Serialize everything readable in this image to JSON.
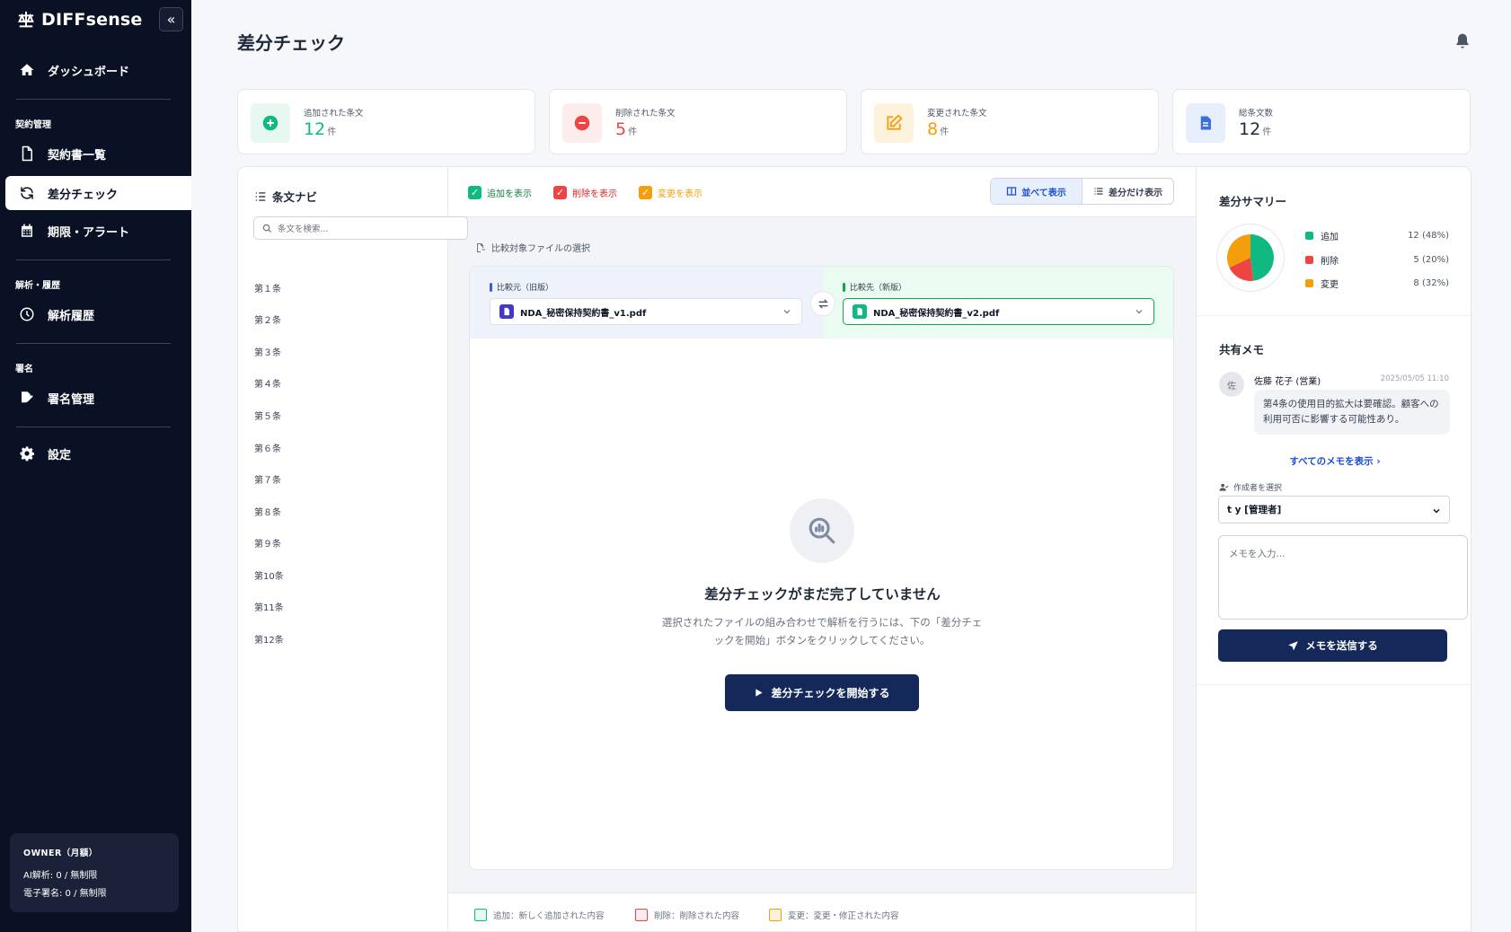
{
  "app": {
    "brand": "DIFFsense"
  },
  "sidebar": {
    "collapse_icon": "chevrons-left-icon",
    "items": [
      {
        "label": "ダッシュボード",
        "icon": "home-icon"
      },
      {
        "label": "契約書一覧",
        "icon": "file-icon"
      },
      {
        "label": "差分チェック",
        "icon": "refresh-icon",
        "active": true
      },
      {
        "label": "期限・アラート",
        "icon": "calendar-icon"
      },
      {
        "label": "解析履歴",
        "icon": "clock-icon"
      },
      {
        "label": "署名管理",
        "icon": "signature-icon"
      },
      {
        "label": "設定",
        "icon": "gear-icon"
      }
    ],
    "sections": [
      "契約管理",
      "解析・履歴",
      "署名"
    ],
    "plan": {
      "title": "OWNER（月額）",
      "ai_usage": "AI解析: 0 / 無制限",
      "esign_usage": "電子署名: 0 / 無制限"
    }
  },
  "header": {
    "title": "差分チェック"
  },
  "stats": [
    {
      "label": "追加された条文",
      "value": "12",
      "unit": "件",
      "color": "#10b981",
      "bg": "#e7f8f0",
      "icon": "plus-circle-icon"
    },
    {
      "label": "削除された条文",
      "value": "5",
      "unit": "件",
      "color": "#ef4444",
      "bg": "#fdecec",
      "icon": "minus-circle-icon"
    },
    {
      "label": "変更された条文",
      "value": "8",
      "unit": "件",
      "color": "#f59e0b",
      "bg": "#fdf3dc",
      "icon": "edit-icon"
    },
    {
      "label": "総条文数",
      "value": "12",
      "unit": "件",
      "color": "#1f2937",
      "bg": "#e8effc",
      "icon": "document-icon"
    }
  ],
  "clause_nav": {
    "title": "条文ナビ",
    "search_placeholder": "条文を検索...",
    "items": [
      "第１条",
      "第２条",
      "第３条",
      "第４条",
      "第５条",
      "第６条",
      "第７条",
      "第８条",
      "第９条",
      "第10条",
      "第11条",
      "第12条"
    ]
  },
  "toolbar": {
    "show_added": "追加を表示",
    "show_deleted": "削除を表示",
    "show_changed": "変更を表示",
    "side_by_side": "並べて表示",
    "diff_only": "差分だけ表示"
  },
  "file_selection": {
    "label": "比較対象ファイルの選択",
    "old_label": "比較元（旧版）",
    "new_label": "比較先（新版）",
    "old_file": "NDA_秘密保持契約書_v1.pdf",
    "new_file": "NDA_秘密保持契約書_v2.pdf"
  },
  "empty_state": {
    "title": "差分チェックがまだ完了していません",
    "description": "選択されたファイルの組み合わせで解析を行うには、下の「差分チェックを開始」ボタンをクリックしてください。",
    "button": "差分チェックを開始する"
  },
  "legend": {
    "added": "追加：新しく追加された内容",
    "deleted": "削除：削除された内容",
    "changed": "変更：変更・修正された内容"
  },
  "summary": {
    "title": "差分サマリー",
    "chart_data": {
      "type": "pie",
      "labels": [
        "追加",
        "削除",
        "変更"
      ],
      "values": [
        12,
        5,
        8
      ],
      "colors": [
        "#10b981",
        "#ef4444",
        "#f59e0b"
      ],
      "display": [
        "12 (48%)",
        "5 (20%)",
        "8 (32%)"
      ]
    }
  },
  "memo": {
    "title": "共有メモ",
    "avatar": "佐",
    "author": "佐藤 花子 (営業)",
    "time": "2025/05/05 11:10",
    "text": "第4条の使用目的拡大は要確認。顧客への利用可否に影響する可能性あり。",
    "view_all": "すべてのメモを表示 ›",
    "author_label": "作成者を選択",
    "author_selected": "t y [管理者]",
    "input_placeholder": "メモを入力...",
    "send": "メモを送信する"
  }
}
